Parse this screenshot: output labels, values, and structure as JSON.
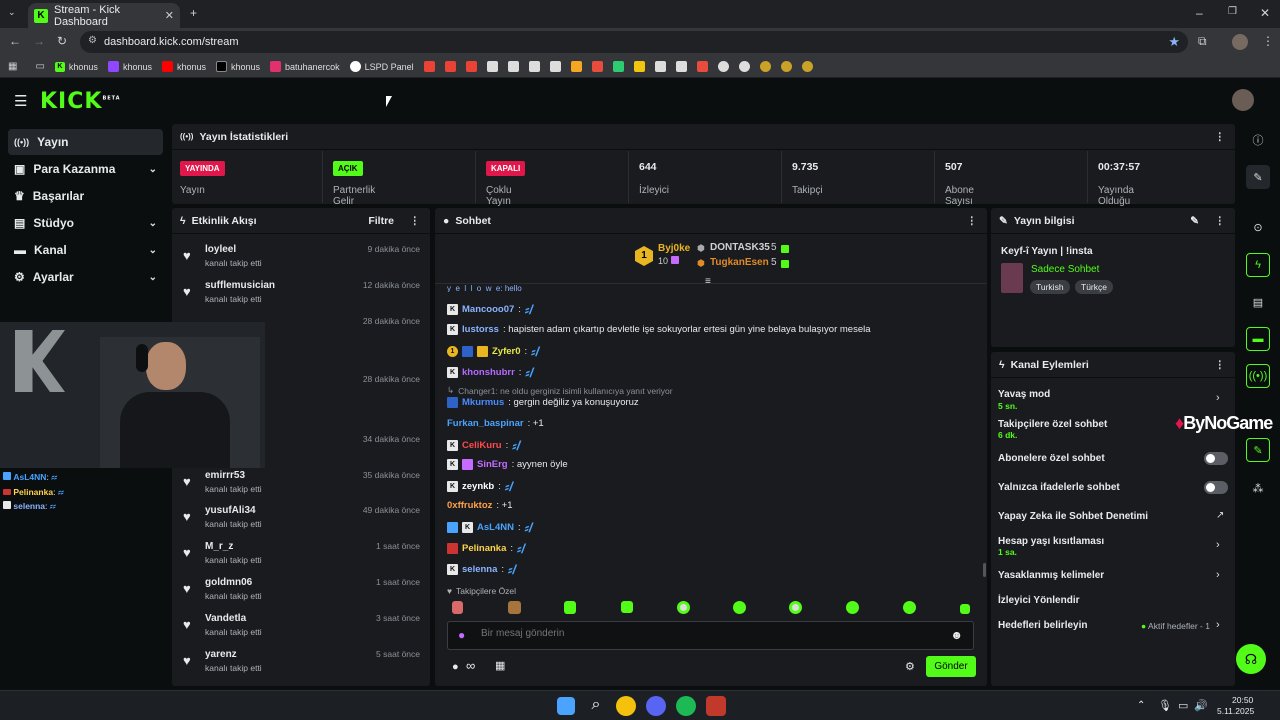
{
  "browser": {
    "tab_title": "Stream - Kick Dashboard",
    "url": "dashboard.kick.com/stream",
    "bookmarks": [
      "khonus",
      "khonus",
      "khonus",
      "khonus",
      "batuhanercok",
      "LSPD Panel"
    ]
  },
  "logo": "KICK",
  "logo_sup": "BETA",
  "nav": {
    "items": [
      {
        "label": "Yayın",
        "icon": "broadcast-icon"
      },
      {
        "label": "Para Kazanma",
        "icon": "wallet-icon"
      },
      {
        "label": "Başarılar",
        "icon": "trophy-icon"
      },
      {
        "label": "Stüdyo",
        "icon": "studio-icon"
      },
      {
        "label": "Kanal",
        "icon": "channel-icon"
      },
      {
        "label": "Ayarlar",
        "icon": "gear-icon"
      }
    ]
  },
  "stats": {
    "title": "Yayın İstatistikleri",
    "items": [
      {
        "value": "YAYINDA",
        "label": "Yayın",
        "color": "#e0174a"
      },
      {
        "value": "AÇIK",
        "label": "Partnerlik Gelir Programı",
        "color": "#53fc18"
      },
      {
        "value": "KAPALI",
        "label": "Çoklu Yayın",
        "color": "#e0174a"
      },
      {
        "value": "644",
        "label": "İzleyici"
      },
      {
        "value": "9.735",
        "label": "Takipçi"
      },
      {
        "value": "507",
        "label": "Abone Sayısı"
      },
      {
        "value": "00:37:57",
        "label": "Yayında Olduğu Süre"
      }
    ]
  },
  "activity": {
    "title": "Etkinlik Akışı",
    "filter": "Filtre",
    "items": [
      {
        "user": "loyleel",
        "action": "kanalı takip etti",
        "time": "9 dakika önce"
      },
      {
        "user": "sufflemusician",
        "action": "kanalı takip etti",
        "time": "12 dakika önce"
      },
      {
        "user": "",
        "action": "",
        "time": "28 dakika önce"
      },
      {
        "user": "",
        "action": "",
        "time": "28 dakika önce"
      },
      {
        "user": "",
        "action": "",
        "time": "34 dakika önce"
      },
      {
        "user": "emirrr53",
        "action": "kanalı takip etti",
        "time": "35 dakika önce"
      },
      {
        "user": "yusufAli34",
        "action": "kanalı takip etti",
        "time": "49 dakika önce"
      },
      {
        "user": "M_r_z",
        "action": "kanalı takip etti",
        "time": "1 saat önce"
      },
      {
        "user": "goldmn06",
        "action": "kanalı takip etti",
        "time": "1 saat önce"
      },
      {
        "user": "Vandetla",
        "action": "kanalı takip etti",
        "time": "3 saat önce"
      },
      {
        "user": "yarenz",
        "action": "kanalı takip etti",
        "time": "5 saat önce"
      }
    ]
  },
  "chat": {
    "title": "Sohbet",
    "leaderboard": [
      {
        "name": "Byj0ke",
        "count": "10",
        "rank": "1"
      },
      {
        "name": "DONTASK35",
        "count": "5"
      },
      {
        "name": "TugkanEsen",
        "count": "5"
      }
    ],
    "messages": [
      {
        "user": "Mancooo07",
        "text": "",
        "color": "#8ab4ff"
      },
      {
        "user": "lustorss",
        "text": ": hapisten adam çıkartıp devletle işe sokuyorlar ertesi gün yine belaya bulaşıyor mesela",
        "color": "#8ab4ff"
      },
      {
        "user": "Zyfer0",
        "text": "",
        "color": "#e6e84a"
      },
      {
        "user": "khonshubrr",
        "text": "",
        "color": "#b46bff"
      },
      {
        "user": "Mkurmus",
        "text": ": gergin değiliz ya konuşuyoruz",
        "color": "#4a8bff",
        "reply": "Changer1: ne oldu gerginiz isimli kullanıcıya yanıt veriyor"
      },
      {
        "user": "Furkan_baspinar",
        "text": ": +1",
        "color": "#4aa3ff"
      },
      {
        "user": "CeliKuru",
        "text": "",
        "color": "#ff4a4a"
      },
      {
        "user": "SinErg",
        "text": ": ayynen öyle",
        "color": "#c56bff"
      },
      {
        "user": "zeynkb",
        "text": "",
        "color": "#ffffff"
      },
      {
        "user": "0xffruktoz",
        "text": ": +1",
        "color": "#ffa04a"
      },
      {
        "user": "AsL4NN",
        "text": "",
        "color": "#4aa3ff"
      },
      {
        "user": "Pelinanka",
        "text": "",
        "color": "#ffd44a"
      },
      {
        "user": "selenna",
        "text": "",
        "color": "#8ab4ff"
      }
    ],
    "mode_label": "Takipçilere Özel",
    "placeholder": "Bir mesaj gönderin",
    "send": "Gönder"
  },
  "overlay_chat": [
    {
      "user": "AsL4NN",
      "sep": ":",
      "color": "#4aa3ff"
    },
    {
      "user": "Pelinanka",
      "sep": ":",
      "color": "#ffd44a"
    },
    {
      "user": "selenna",
      "sep": ":",
      "color": "#8ab4ff"
    }
  ],
  "stream_info": {
    "title": "Yayın bilgisi",
    "stream_title": "Keyf-î Yayın | !insta",
    "category": "Sadece Sohbet",
    "tags": [
      "Turkish",
      "Türkçe"
    ]
  },
  "actions": {
    "title": "Kanal Eylemleri",
    "items": [
      {
        "label": "Yavaş mod",
        "sub": "5 sn."
      },
      {
        "label": "Takipçilere özel sohbet",
        "sub": "6 dk."
      },
      {
        "label": "Abonelere özel sohbet",
        "toggle": false
      },
      {
        "label": "Yalnızca ifadelerle sohbet",
        "toggle": false
      },
      {
        "label": "Yapay Zeka ile Sohbet Denetimi"
      },
      {
        "label": "Hesap yaşı kısıtlaması",
        "sub": "1 sa."
      },
      {
        "label": "Yasaklanmış kelimeler"
      },
      {
        "label": "İzleyici Yönlendir"
      },
      {
        "label": "Hedefleri belirleyin",
        "status": "Aktif hedefler - 1"
      }
    ]
  },
  "watermark": "ByNoGame",
  "taskbar": {
    "time": "20:50",
    "date": "5.11.2025"
  }
}
